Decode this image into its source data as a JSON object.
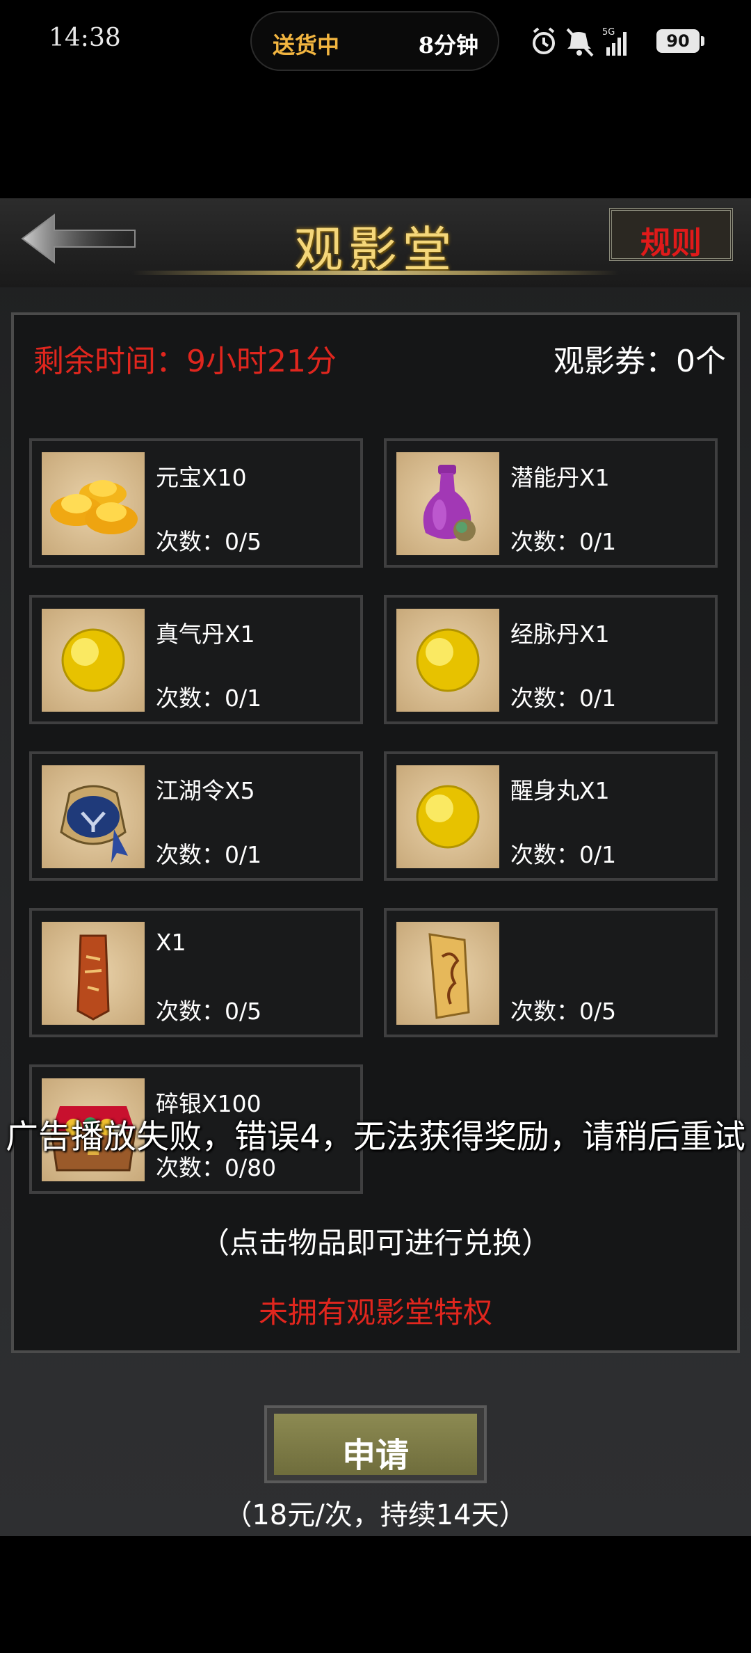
{
  "status": {
    "time": "14:38",
    "pill_left": "送货中",
    "pill_right": "8分钟",
    "battery": "90"
  },
  "header": {
    "title": "观影堂",
    "rules_label": "规则"
  },
  "info": {
    "remaining": "剩余时间：9小时21分",
    "tickets": "观影券：0个"
  },
  "items": [
    {
      "name": "元宝X10",
      "count": "次数：0/5",
      "icon": "gold-ingot-icon"
    },
    {
      "name": "潜能丹X1",
      "count": "次数：0/1",
      "icon": "potion-bottle-icon"
    },
    {
      "name": "真气丹X1",
      "count": "次数：0/1",
      "icon": "yellow-pill-icon"
    },
    {
      "name": "经脉丹X1",
      "count": "次数：0/1",
      "icon": "yellow-pill-icon"
    },
    {
      "name": "江湖令X5",
      "count": "次数：0/1",
      "icon": "token-bag-icon"
    },
    {
      "name": "醒身丸X1",
      "count": "次数：0/1",
      "icon": "yellow-pill-icon"
    },
    {
      "name": "X1",
      "count": "次数：0/5",
      "icon": "scroll-token-icon"
    },
    {
      "name": "",
      "count": "次数：0/5",
      "icon": "paper-talisman-icon"
    },
    {
      "name": "碎银X100",
      "count": "次数：0/80",
      "icon": "treasure-chest-icon"
    }
  ],
  "hint": "（点击物品即可进行兑换）",
  "no_privilege": "未拥有观影堂特权",
  "apply_label": "申请",
  "price": "（18元/次，持续14天）",
  "toast": "广告播放失败，错误4，无法获得奖励，请稍后重试"
}
